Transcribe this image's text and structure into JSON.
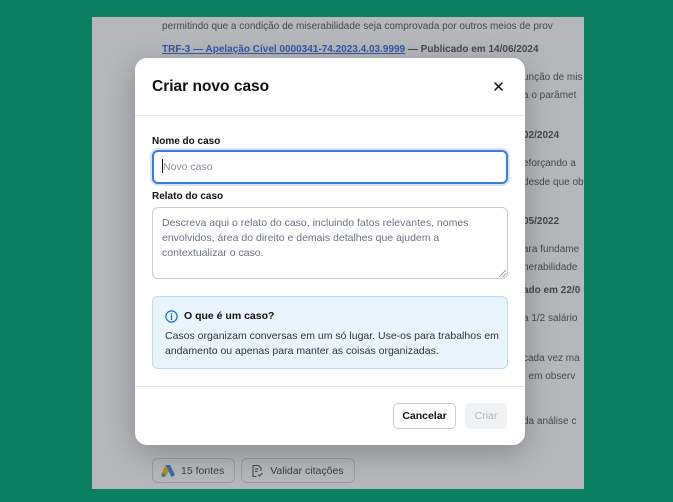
{
  "background": {
    "top_text": "permitindo que a condição de miserabilidade seja comprovada por outros meios de prov",
    "citation": {
      "link": "TRF-3 — Apelação Cível 0000341-74.2023.4.03.9999",
      "published": " — Publicado em 14/06/2024"
    },
    "right_fragments": [
      {
        "text": "unção de mis",
        "bold": false
      },
      {
        "text": "a o parâmet",
        "bold": false
      },
      {
        "text": "02/2024",
        "bold": true
      },
      {
        "text": "eforçando a",
        "bold": false
      },
      {
        "text": "desde que ob",
        "bold": false
      },
      {
        "text": "05/2022",
        "bold": true
      },
      {
        "text": "ara fundame",
        "bold": false
      },
      {
        "text": "nerabilidade",
        "bold": false
      },
      {
        "text": "ado em 22/0",
        "bold": true
      },
      {
        "text": "a 1/2 salário",
        "bold": false
      },
      {
        "text": "cada vez ma",
        "bold": false
      },
      {
        "text": ", em observ",
        "bold": false
      },
      {
        "text": "da análise c",
        "bold": false
      }
    ],
    "chips": {
      "sources": "15 fontes",
      "validate": "Validar citações"
    }
  },
  "modal": {
    "title": "Criar novo caso",
    "name_label": "Nome do caso",
    "name_placeholder": "Novo caso",
    "name_value": "",
    "story_label": "Relato do caso",
    "story_placeholder": "Descreva aqui o relato do caso, incluindo fatos relevantes, nomes envolvidos, área do direito e demais detalhes que ajudem a contextualizar o caso.",
    "info": {
      "title": "O que é um caso?",
      "text": "Casos organizam conversas em um só lugar. Use-os para trabalhos em andamento ou apenas para manter as coisas organizadas."
    },
    "cancel_label": "Cancelar",
    "create_label": "Criar"
  },
  "colors": {
    "outer_background": "#0a8060",
    "focus_border": "#3b7ddd",
    "info_background": "#eaf4fd",
    "info_accent": "#1a73c8",
    "link": "#1a4fd6"
  },
  "icons": {
    "close": "close-icon",
    "info": "info-icon",
    "sources": "sources-logo-icon",
    "validate": "document-check-icon"
  }
}
